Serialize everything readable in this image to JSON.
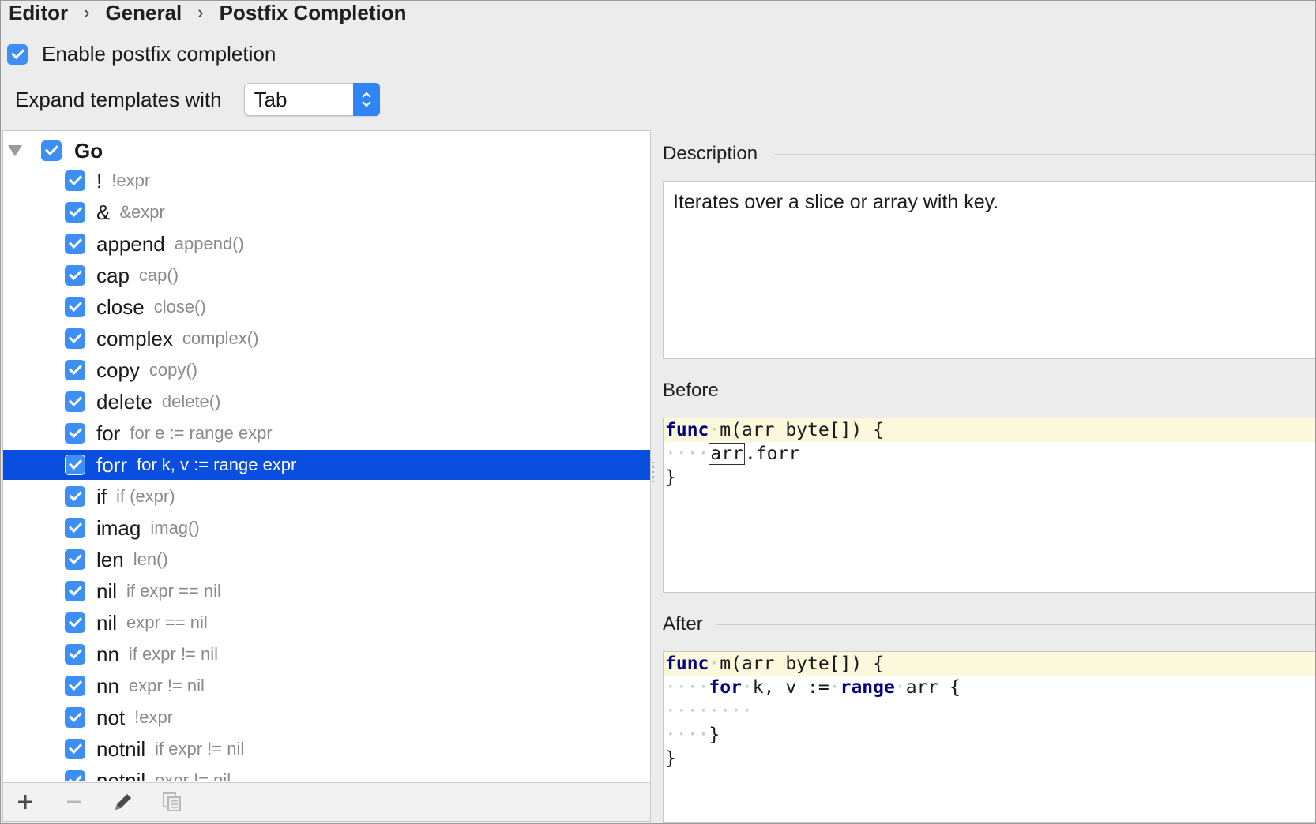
{
  "breadcrumb": [
    "Editor",
    "General",
    "Postfix Completion"
  ],
  "breadcrumb_sep": "›",
  "enable": {
    "label": "Enable postfix completion",
    "checked": true
  },
  "expand": {
    "label": "Expand templates with",
    "value": "Tab"
  },
  "tree": {
    "root": {
      "label": "Go",
      "checked": true,
      "expanded": true
    },
    "items": [
      {
        "key": "!",
        "example": "!expr"
      },
      {
        "key": "&",
        "example": "&expr"
      },
      {
        "key": "append",
        "example": "append()"
      },
      {
        "key": "cap",
        "example": "cap()"
      },
      {
        "key": "close",
        "example": "close()"
      },
      {
        "key": "complex",
        "example": "complex()"
      },
      {
        "key": "copy",
        "example": "copy()"
      },
      {
        "key": "delete",
        "example": "delete()"
      },
      {
        "key": "for",
        "example": "for e := range expr"
      },
      {
        "key": "forr",
        "example": "for k, v := range expr",
        "selected": true
      },
      {
        "key": "if",
        "example": "if (expr)"
      },
      {
        "key": "imag",
        "example": "imag()"
      },
      {
        "key": "len",
        "example": "len()"
      },
      {
        "key": "nil",
        "example": "if expr == nil"
      },
      {
        "key": "nil",
        "example": "expr == nil"
      },
      {
        "key": "nn",
        "example": "if expr != nil"
      },
      {
        "key": "nn",
        "example": "expr != nil"
      },
      {
        "key": "not",
        "example": "!expr"
      },
      {
        "key": "notnil",
        "example": "if expr != nil"
      },
      {
        "key": "notnil",
        "example": "expr != nil"
      }
    ]
  },
  "toolbar": {
    "add_icon": "plus-icon",
    "remove_icon": "minus-icon",
    "edit_icon": "pencil-icon",
    "copy_icon": "copy-icon"
  },
  "description": {
    "title": "Description",
    "text": "Iterates over a slice or array with key."
  },
  "before": {
    "title": "Before",
    "line1_kw": "func",
    "line1_rest": "m(arr byte[]) {",
    "line2_var": "arr",
    "line2_rest": ".forr",
    "line3": "}"
  },
  "after": {
    "title": "After",
    "line1_kw": "func",
    "line1_rest": "m(arr byte[]) {",
    "line2_kw1": "for",
    "line2_mid": "k, v :=",
    "line2_kw2": "range",
    "line2_rest": "arr {",
    "line4": "}",
    "line5": "}"
  },
  "colors": {
    "accent": "#3d8ef5",
    "selection": "#0a4ee0",
    "keyword": "#000080"
  }
}
